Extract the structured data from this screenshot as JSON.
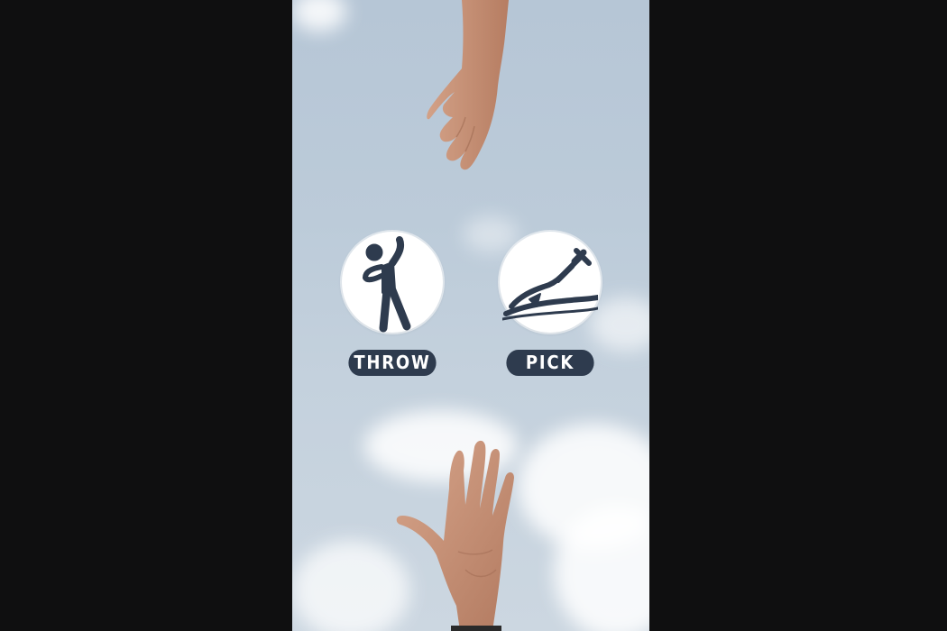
{
  "actions": {
    "throw": {
      "label": "THROW",
      "icon": "person-throwing-icon"
    },
    "pick": {
      "label": "PICK",
      "icon": "message-in-bottle-icon"
    }
  },
  "colors": {
    "button_fill": "#2e3b4e",
    "icon_color": "#2e3b4e",
    "circle_fill": "#ffffff",
    "sky": "#bccbd9",
    "letterbox": "#0f0f10"
  }
}
